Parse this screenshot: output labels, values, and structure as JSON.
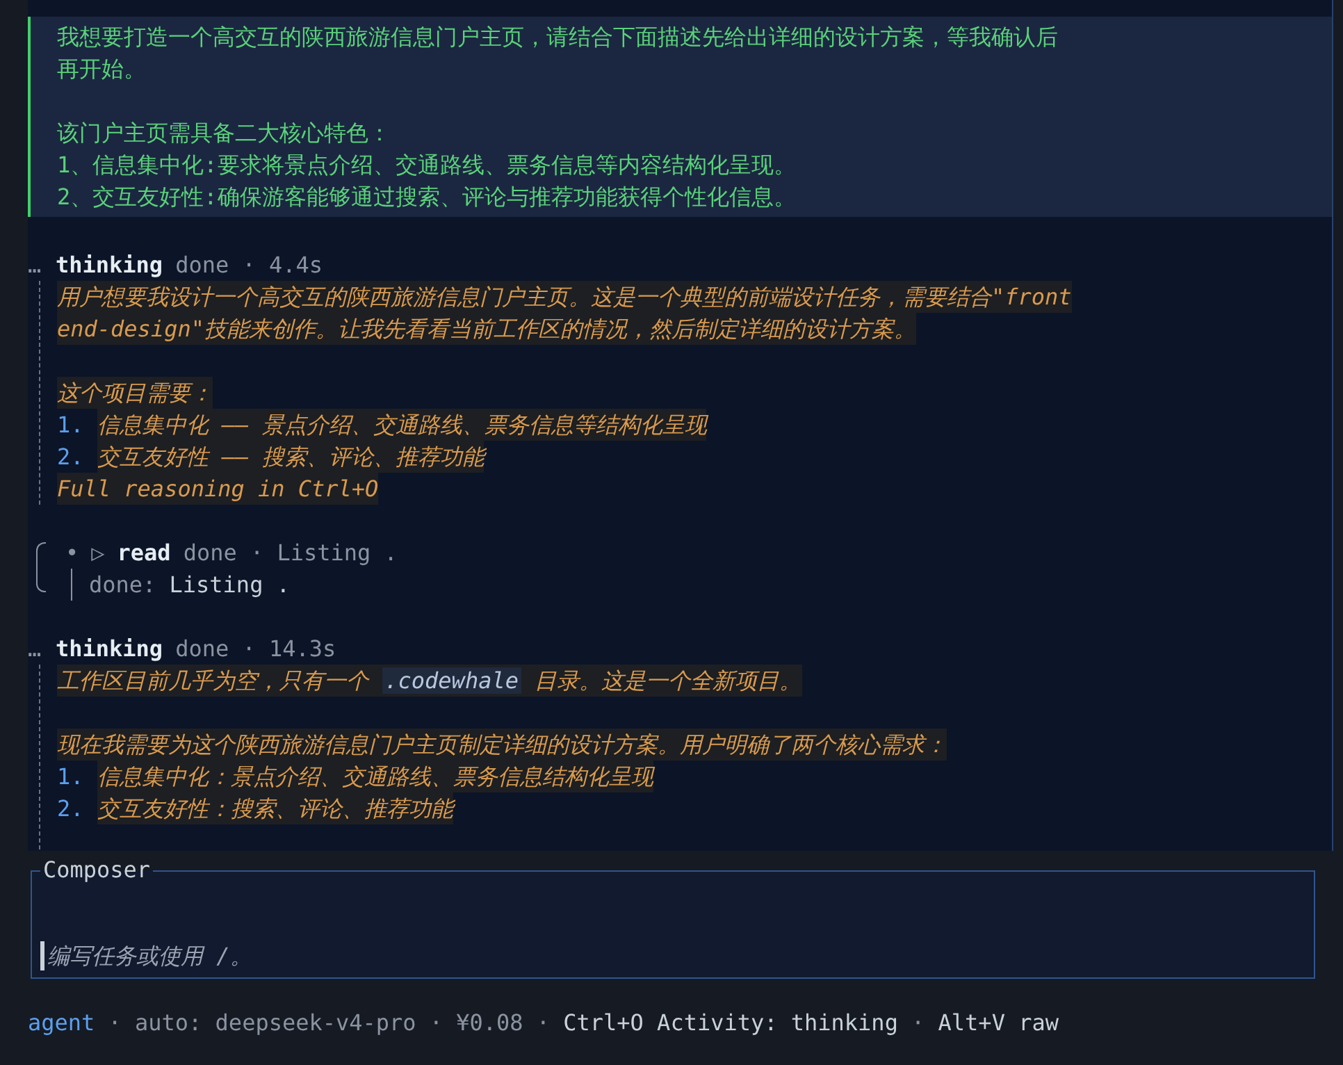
{
  "user_message": {
    "paragraphs": [
      [
        "我想要打造一个高交互的陕西旅游信息门户主页，请结合下面描述先给出详细的设计方案，等我确认后",
        "再开始。"
      ],
      [
        "该门户主页需具备二大核心特色：",
        "1、信息集中化:要求将景点介绍、交通路线、票务信息等内容结构化呈现。",
        "2、交互友好性:确保游客能够通过搜索、评论与推荐功能获得个性化信息。"
      ]
    ]
  },
  "transcript": [
    {
      "kind": "thinking",
      "marker": "…",
      "title": "thinking",
      "meta": "done · 4.4s",
      "trailing_space": false,
      "paragraphs": [
        [
          {
            "parts": [
              {
                "kind": "text",
                "text": "用户想要我设计一个高交互的陕西旅游信息门户主页。这是一个典型的前端设计任务，需要结合\"front"
              }
            ]
          },
          {
            "parts": [
              {
                "kind": "text",
                "text": "end-design\"技能来创作。让我先看看当前工作区的情况，然后制定详细的设计方案。"
              }
            ]
          }
        ],
        [
          {
            "parts": [
              {
                "kind": "text",
                "text": "这个项目需要："
              }
            ]
          },
          {
            "number": "1.",
            "parts": [
              {
                "kind": "text",
                "text": "信息集中化 —— 景点介绍、交通路线、票务信息等结构化呈现"
              }
            ]
          },
          {
            "number": "2.",
            "parts": [
              {
                "kind": "text",
                "text": "交互友好性 —— 搜索、评论、推荐功能"
              }
            ]
          },
          {
            "parts": [
              {
                "kind": "text",
                "text": "Full reasoning in Ctrl+O"
              }
            ]
          }
        ]
      ]
    },
    {
      "kind": "tool",
      "bullet": "•",
      "icon": "▷",
      "title": "read",
      "meta": "done · Listing .",
      "result_label": "done:",
      "result": "Listing ."
    },
    {
      "kind": "thinking",
      "marker": "…",
      "title": "thinking",
      "meta": "done · 14.3s",
      "trailing_space": true,
      "paragraphs": [
        [
          {
            "parts": [
              {
                "kind": "text",
                "text": "工作区目前几乎为空，只有一个 "
              },
              {
                "kind": "code",
                "text": ".codewhale"
              },
              {
                "kind": "text",
                "text": " 目录。这是一个全新项目。"
              }
            ]
          }
        ],
        [
          {
            "parts": [
              {
                "kind": "text",
                "text": "现在我需要为这个陕西旅游信息门户主页制定详细的设计方案。用户明确了两个核心需求："
              }
            ]
          },
          {
            "number": "1.",
            "parts": [
              {
                "kind": "text",
                "text": "信息集中化：景点介绍、交通路线、票务信息结构化呈现"
              }
            ]
          },
          {
            "number": "2.",
            "parts": [
              {
                "kind": "text",
                "text": "交互友好性：搜索、评论、推荐功能"
              }
            ]
          }
        ]
      ]
    }
  ],
  "composer": {
    "legend": "Composer",
    "placeholder": "编写任务或使用 /。"
  },
  "status_bar": [
    {
      "kind": "mode",
      "text": "agent"
    },
    {
      "kind": "sep",
      "text": "·"
    },
    {
      "kind": "muted",
      "text": "auto: deepseek-v4-pro"
    },
    {
      "kind": "sep",
      "text": "·"
    },
    {
      "kind": "muted",
      "text": "¥0.08"
    },
    {
      "kind": "sep",
      "text": "·"
    },
    {
      "kind": "plain",
      "text": "Ctrl+O Activity: thinking"
    },
    {
      "kind": "sep",
      "text": "·"
    },
    {
      "kind": "plain",
      "text": "Alt+V raw"
    }
  ]
}
